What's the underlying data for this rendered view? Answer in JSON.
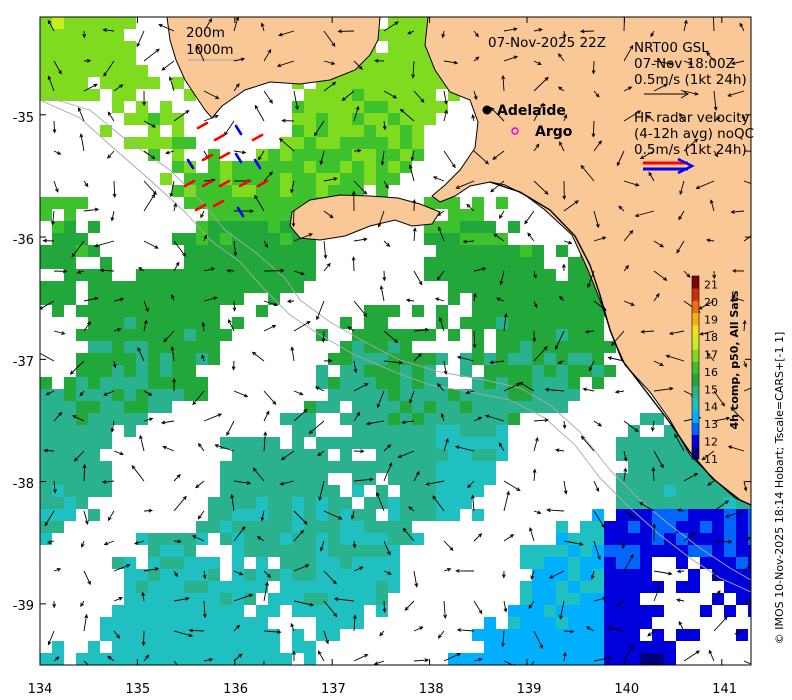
{
  "map": {
    "timestamp": "07-Nov-2025 22Z",
    "contour_legend": [
      "200m",
      "1000m"
    ],
    "x_ticks": [
      "134",
      "135",
      "136",
      "137",
      "138",
      "139",
      "140",
      "141"
    ],
    "y_ticks": [
      "-35",
      "-36",
      "-37",
      "-38",
      "-39"
    ],
    "lon_range": [
      134,
      141.3
    ],
    "lat_range": [
      -39.5,
      -34.2
    ],
    "places": [
      {
        "name": "Adelaide",
        "lon": 138.6,
        "lat": -34.93,
        "marker": "filled-circle"
      },
      {
        "name": "Argo",
        "lon": 138.85,
        "lat": -35.12,
        "marker": "open-circle"
      }
    ],
    "colors": {
      "land": "#f9c896",
      "ocean": "#ffffff",
      "coast": "#000000",
      "contour": "#a8a8a8"
    }
  },
  "legend_model": {
    "title": "NRT00 GSL",
    "date": "07-Nov 18:00Z",
    "scale": "0.5m/s (1kt 24h)"
  },
  "legend_radar": {
    "title": "HF radar velocity",
    "subtitle": "(4-12h avg) noQC",
    "scale": "0.5m/s (1kt 24h)",
    "colors": [
      "#ff0000",
      "#0000ff"
    ]
  },
  "colorbar": {
    "title": "4h comp, p50, All Sats",
    "labels": [
      "21",
      "20",
      "19",
      "18",
      "17",
      "16",
      "15",
      "14",
      "13",
      "12",
      "11"
    ],
    "range": [
      11,
      21.5
    ],
    "colors": [
      "#00007f",
      "#0000dd",
      "#0066ff",
      "#00b0ff",
      "#20c0c0",
      "#2ab28f",
      "#22a83a",
      "#3dc22d",
      "#7fdb20",
      "#c8ee20",
      "#f0e020",
      "#f5b015",
      "#ec7010",
      "#cc3010",
      "#800000"
    ]
  },
  "credit": "© IMOS 10-Nov-2025 18:14 Hobart; Tscale=CARS+[-1 1]"
}
